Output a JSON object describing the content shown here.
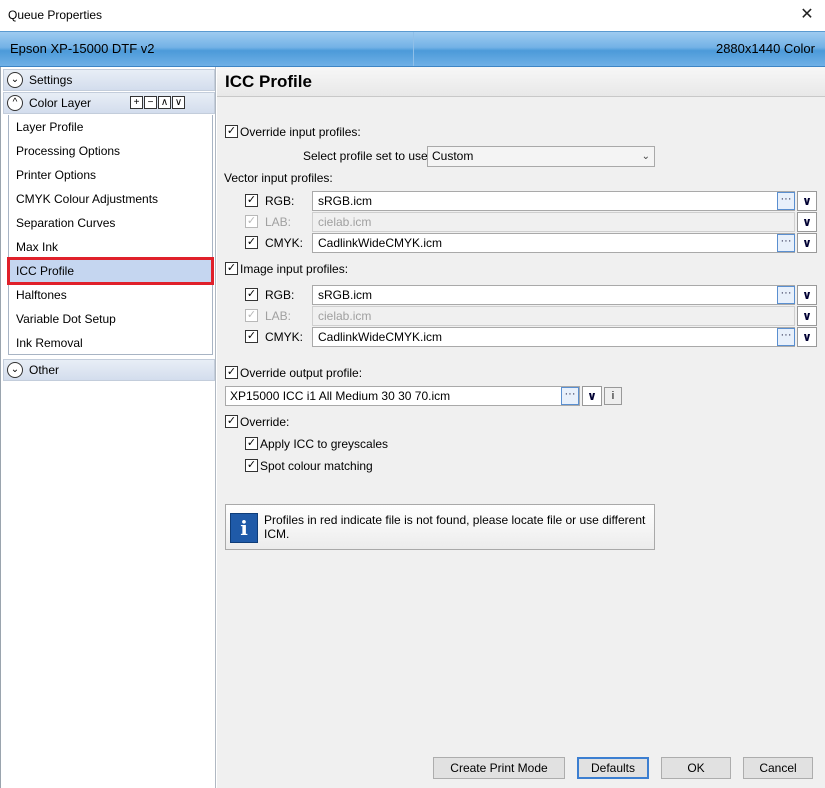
{
  "window": {
    "title": "Queue Properties",
    "close_glyph": "✕"
  },
  "header": {
    "printer": "Epson XP-15000 DTF v2",
    "resolution": "2880x1440 Color"
  },
  "sidebar": {
    "settings_label": "Settings",
    "color_layer_label": "Color Layer",
    "tools": [
      "+",
      "−",
      "∧",
      "∨"
    ],
    "items": [
      "Layer Profile",
      "Processing Options",
      "Printer Options",
      "CMYK Colour Adjustments",
      "Separation Curves",
      "Max Ink",
      "ICC Profile",
      "Halftones",
      "Variable Dot Setup",
      "Ink Removal"
    ],
    "selected_item": "ICC Profile",
    "other_label": "Other"
  },
  "main": {
    "title": "ICC Profile",
    "override_input_label": "Override input profiles:",
    "profile_set_label": "Select profile set to use:",
    "profile_set_value": "Custom",
    "vector_label": "Vector input profiles:",
    "vector": {
      "rgb_label": "RGB:",
      "rgb_value": "sRGB.icm",
      "lab_label": "LAB:",
      "lab_value": "cielab.icm",
      "cmyk_label": "CMYK:",
      "cmyk_value": "CadlinkWideCMYK.icm"
    },
    "image_label": "Image input profiles:",
    "image": {
      "rgb_label": "RGB:",
      "rgb_value": "sRGB.icm",
      "lab_label": "LAB:",
      "lab_value": "cielab.icm",
      "cmyk_label": "CMYK:",
      "cmyk_value": "CadlinkWideCMYK.icm"
    },
    "override_output_label": "Override output profile:",
    "output_value": "XP15000 ICC i1 All Medium 30 30 70.icm",
    "info_button": "i",
    "override_label": "Override:",
    "apply_icc_label": "Apply ICC to greyscales",
    "spot_label": "Spot colour matching",
    "info_text": "Profiles in red indicate file is not found, please locate file or use different ICM.",
    "info_icon": "i"
  },
  "buttons": {
    "create": "Create Print Mode",
    "defaults": "Defaults",
    "ok": "OK",
    "cancel": "Cancel"
  },
  "glyphs": {
    "check": "✓",
    "dots": "···",
    "down": "∨",
    "chev_down": "⌄",
    "chev_up": "^"
  },
  "colors": {
    "header_blue": "#6fb0e6",
    "selection_outline": "#e0202a",
    "selected_bg": "#c5d6f0"
  }
}
